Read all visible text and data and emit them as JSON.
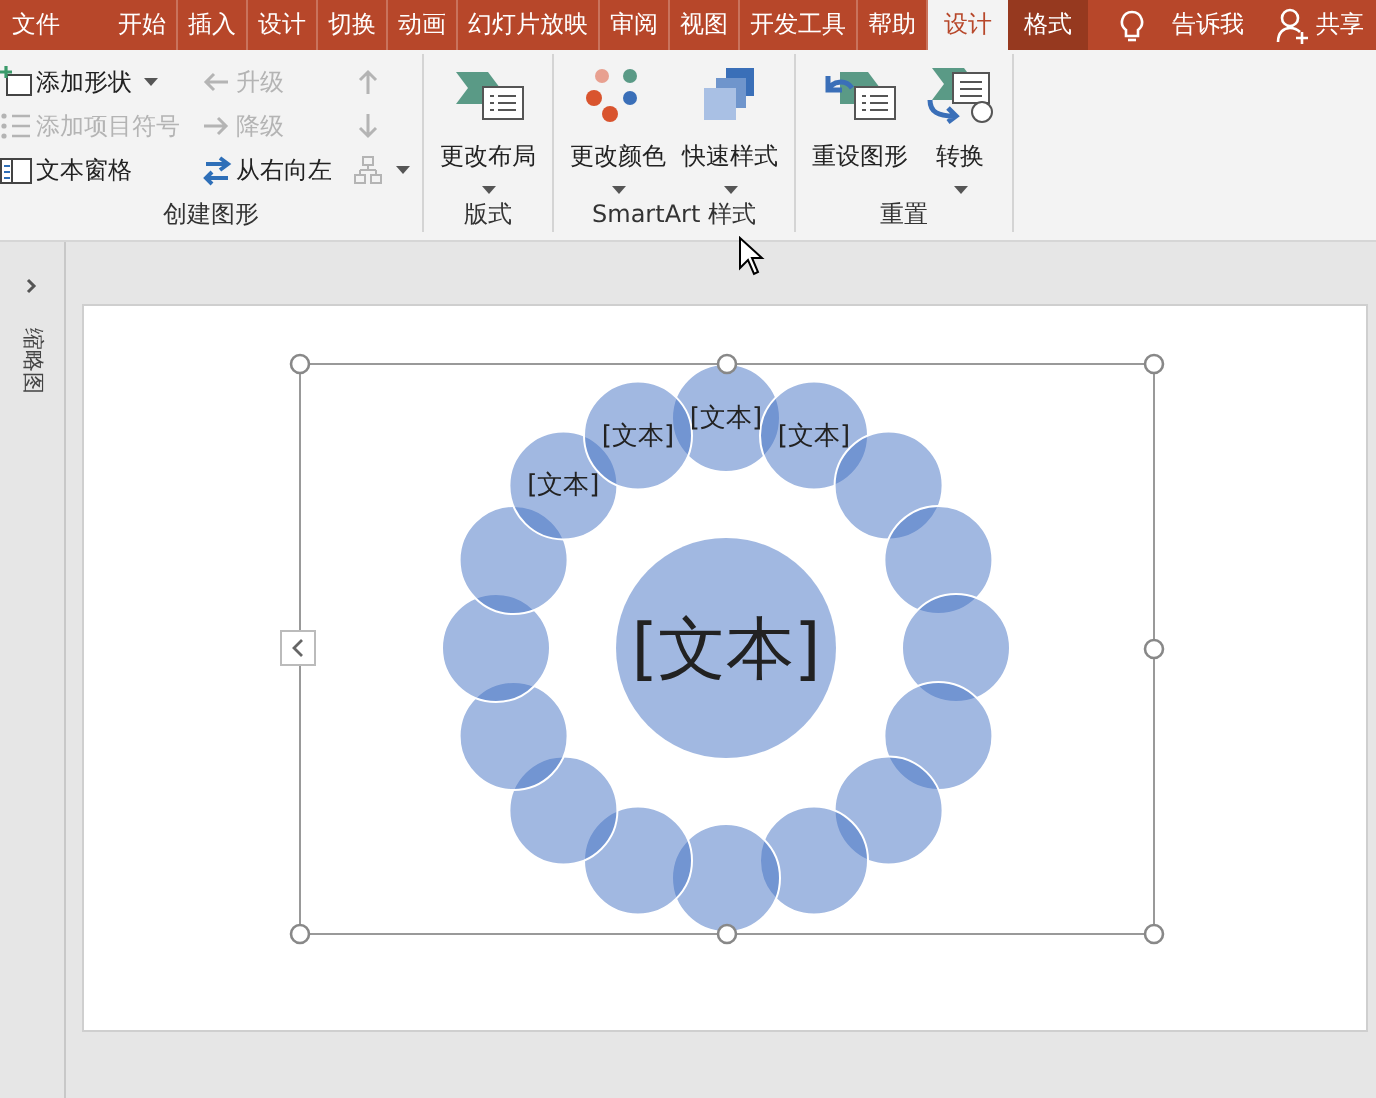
{
  "menu_tabs": [
    {
      "label": "文件",
      "selected": false,
      "kind": "file"
    },
    {
      "label": "开始",
      "selected": false,
      "kind": "tab"
    },
    {
      "label": "插入",
      "selected": false,
      "kind": "tab"
    },
    {
      "label": "设计",
      "selected": false,
      "kind": "tab"
    },
    {
      "label": "切换",
      "selected": false,
      "kind": "tab"
    },
    {
      "label": "动画",
      "selected": false,
      "kind": "tab"
    },
    {
      "label": "幻灯片放映",
      "selected": false,
      "kind": "tab"
    },
    {
      "label": "审阅",
      "selected": false,
      "kind": "tab"
    },
    {
      "label": "视图",
      "selected": false,
      "kind": "tab"
    },
    {
      "label": "开发工具",
      "selected": false,
      "kind": "tab"
    },
    {
      "label": "帮助",
      "selected": false,
      "kind": "tab"
    },
    {
      "label": "设计",
      "selected": true,
      "kind": "context"
    },
    {
      "label": "格式",
      "selected": false,
      "kind": "context"
    }
  ],
  "tell_me": {
    "label": "告诉我"
  },
  "share": {
    "label": "共享"
  },
  "ribbon_groups": [
    {
      "label": "创建图形",
      "kind": "small",
      "items": [
        {
          "label": "添加形状",
          "disabled": false,
          "dropdown": true
        },
        {
          "label": "升级",
          "disabled": true,
          "dropdown": false
        },
        {
          "disabled": true,
          "dropdown": false
        },
        {
          "label": "添加项目符号",
          "disabled": true,
          "dropdown": false
        },
        {
          "label": "降级",
          "disabled": true,
          "dropdown": false
        },
        {
          "disabled": true,
          "dropdown": false
        },
        {
          "label": "文本窗格",
          "disabled": false,
          "dropdown": false
        },
        {
          "label": "从右向左",
          "disabled": false,
          "dropdown": false
        },
        {
          "disabled": true,
          "dropdown": true
        }
      ]
    },
    {
      "label": "版式",
      "kind": "large",
      "items": [
        {
          "label": "更改布局",
          "disabled": false,
          "dropdown": true
        }
      ]
    },
    {
      "label": "SmartArt 样式",
      "kind": "large",
      "items": [
        {
          "label": "更改颜色",
          "disabled": false,
          "dropdown": true
        },
        {
          "label": "快速样式",
          "disabled": false,
          "dropdown": true
        }
      ]
    },
    {
      "label": "重置",
      "kind": "large",
      "items": [
        {
          "label": "重设图形",
          "disabled": false,
          "dropdown": false
        },
        {
          "label": "转换",
          "disabled": false,
          "dropdown": true
        }
      ]
    }
  ],
  "thumbnail_pane": {
    "label": "缩略图",
    "expanded": false
  },
  "smartart": {
    "center": {
      "label": "[文本]"
    },
    "nodes": [
      {
        "kind": "text",
        "label": "[文本]"
      },
      {
        "kind": "text",
        "label": "[文本]"
      },
      {
        "kind": "blank"
      },
      {
        "kind": "blank"
      },
      {
        "kind": "blank"
      },
      {
        "kind": "blank"
      },
      {
        "kind": "blank"
      },
      {
        "kind": "blank"
      },
      {
        "kind": "blank"
      },
      {
        "kind": "blank"
      },
      {
        "kind": "blank"
      },
      {
        "kind": "blank"
      },
      {
        "kind": "blank"
      },
      {
        "kind": "blank"
      },
      {
        "kind": "text",
        "label": "[文本]"
      },
      {
        "kind": "text",
        "label": "[文本]"
      }
    ],
    "selected": true
  }
}
